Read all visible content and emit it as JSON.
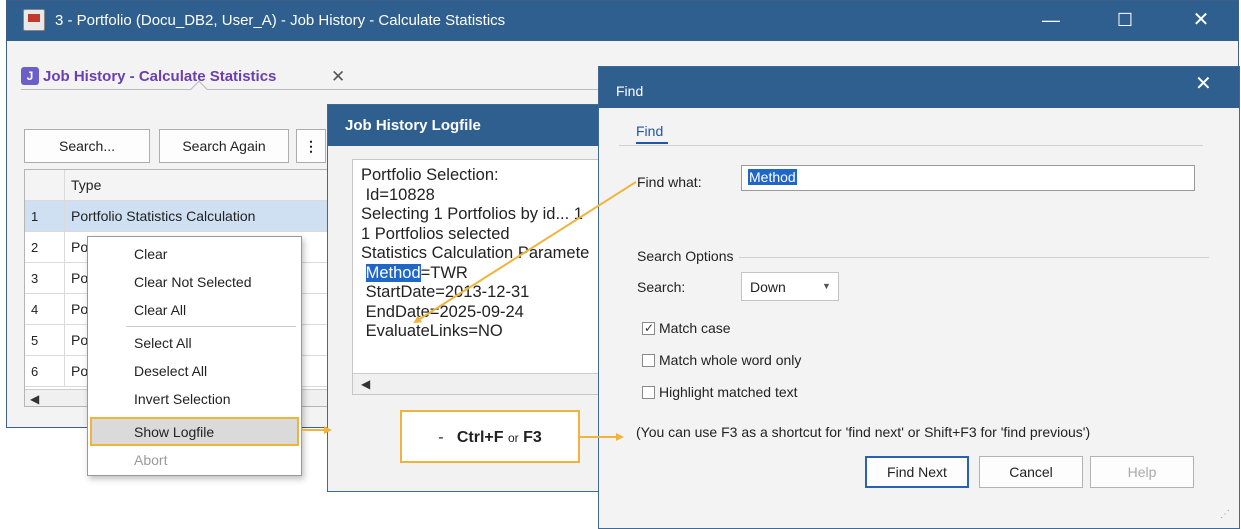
{
  "main_window": {
    "title": "3 - Portfolio (Docu_DB2, User_A) - Job History  - Calculate Statistics",
    "controls": {
      "minimize": "—",
      "maximize": "☐",
      "close": "✕"
    },
    "tab": {
      "icon_letter": "J",
      "label": "Job History  - Calculate Statistics",
      "close": "✕"
    },
    "toolbar": {
      "search": "Search...",
      "search_again": "Search Again",
      "more": "⋮"
    },
    "grid": {
      "column": "Type",
      "rows": [
        {
          "num": "1",
          "type": "Portfolio Statistics Calculation"
        },
        {
          "num": "2",
          "type": "Po"
        },
        {
          "num": "3",
          "type": "Po"
        },
        {
          "num": "4",
          "type": "Po"
        },
        {
          "num": "5",
          "type": "Po"
        },
        {
          "num": "6",
          "type": "Po"
        }
      ],
      "scroll_left": "◀"
    }
  },
  "context_menu": {
    "items": [
      {
        "label": "Clear",
        "enabled": true
      },
      {
        "label": "Clear Not Selected",
        "enabled": true
      },
      {
        "label": "Clear All",
        "enabled": true
      },
      {
        "label": "Select All",
        "enabled": true
      },
      {
        "label": "Deselect All",
        "enabled": true
      },
      {
        "label": "Invert Selection",
        "enabled": true
      },
      {
        "label": "Show Logfile",
        "enabled": true,
        "highlighted": true
      },
      {
        "label": "Abort",
        "enabled": false
      }
    ]
  },
  "log_window": {
    "title": "Job History Logfile",
    "lines": [
      "Portfolio Selection:",
      " Id=10828",
      "Selecting 1 Portfolios by id... 1",
      "1 Portfolios selected",
      "Statistics Calculation Paramete",
      "StartDate=2013-12-31",
      "EndDate=2025-09-24",
      "EvaluateLinks=NO"
    ],
    "method_key": "Method",
    "method_value": "=TWR",
    "scroll_left": "◀"
  },
  "annotation": {
    "prefix": "-",
    "key1": "Ctrl+F",
    "or": "or",
    "key2": "F3"
  },
  "find_dialog": {
    "title": "Find",
    "close": "✕",
    "tab": "Find",
    "find_what_label": "Find what:",
    "find_what_value": "Method",
    "search_options_label": "Search Options",
    "search_label": "Search:",
    "direction": "Down",
    "direction_arrow": "▼",
    "match_case": {
      "label": "Match case",
      "checked": true
    },
    "match_whole_word": {
      "label": "Match whole word only",
      "checked": false
    },
    "highlight": {
      "label": "Highlight matched text",
      "checked": false
    },
    "hint": "(You can use F3 as a shortcut for 'find next' or Shift+F3 for 'find previous')",
    "buttons": {
      "find_next": "Find Next",
      "cancel": "Cancel",
      "help": "Help"
    },
    "grip": "⋰"
  },
  "colors": {
    "title_bar": "#2f5f8f",
    "highlight_accent": "#f0b43c",
    "selection": "#1f66c9",
    "tab_label": "#6a3fb0"
  }
}
